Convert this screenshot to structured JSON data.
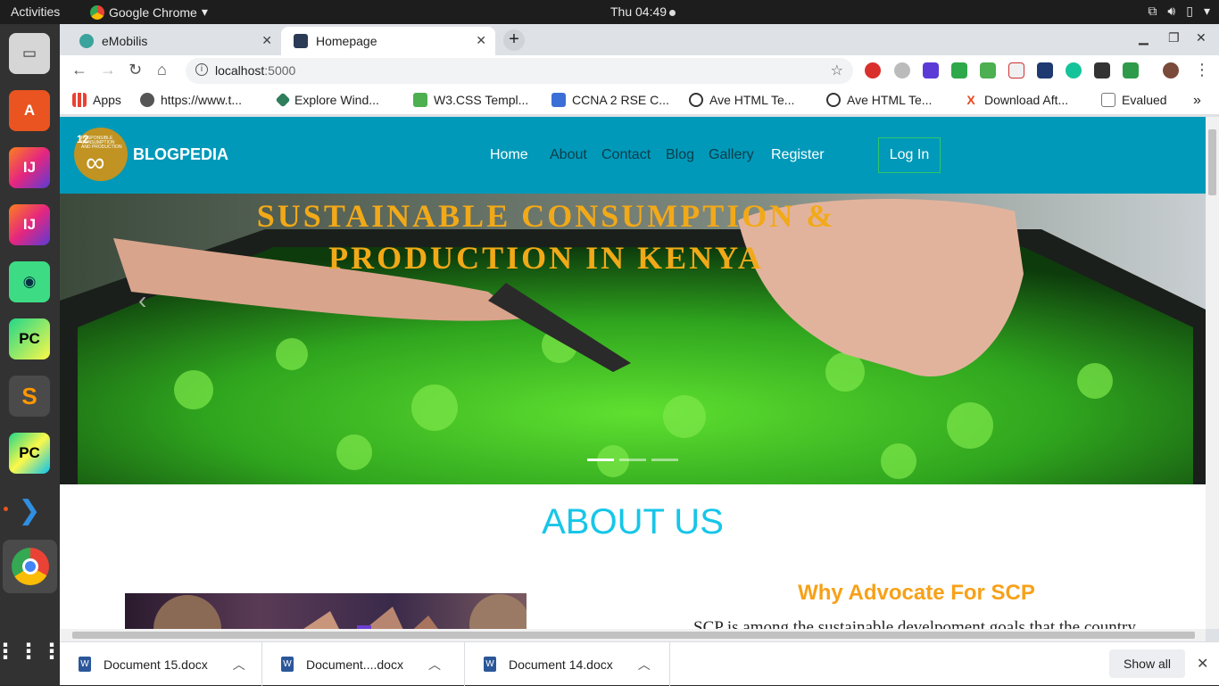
{
  "topbar": {
    "activities": "Activities",
    "app_name": "Google Chrome",
    "clock": "Thu 04:49"
  },
  "dock": {
    "items": [
      "files",
      "software-center",
      "intellij-idea",
      "intellij-idea",
      "android-studio",
      "pycharm",
      "sublime-text",
      "pycharm",
      "vscode",
      "chrome"
    ]
  },
  "browser": {
    "tabs": [
      {
        "title": "eMobilis",
        "active": false
      },
      {
        "title": "Homepage",
        "active": true
      }
    ],
    "url_host": "localhost",
    "url_port": ":5000",
    "bookmarks": [
      {
        "label": "Apps",
        "color": "#e94235"
      },
      {
        "label": "https://www.t...",
        "color": "#555555"
      },
      {
        "label": "Explore Wind...",
        "color": "#2e7d5b"
      },
      {
        "label": "W3.CSS Templ...",
        "color": "#4caf50"
      },
      {
        "label": "CCNA 2 RSE C...",
        "color": "#3b6fd6"
      },
      {
        "label": "Ave HTML Te...",
        "color": "#333333"
      },
      {
        "label": "Ave HTML Te...",
        "color": "#333333"
      },
      {
        "label": "Download Aft...",
        "color": "#e8461e"
      },
      {
        "label": "Evalued",
        "color": "#777777"
      }
    ]
  },
  "site": {
    "logo_text": "RESPONSIBLE CONSUMPTION AND PRODUCTION",
    "logo_number": "12",
    "brand": "BLOGPEDIA",
    "nav": [
      {
        "label": "Home",
        "color": "#ffffff"
      },
      {
        "label": "About",
        "color": "#0b3d4a"
      },
      {
        "label": "Contact",
        "color": "#0b3d4a"
      },
      {
        "label": "Blog",
        "color": "#0b3d4a"
      },
      {
        "label": "Gallery",
        "color": "#0b3d4a"
      },
      {
        "label": "Register",
        "color": "#ffffff"
      }
    ],
    "login": "Log In",
    "hero_title_line1": "SUSTAINABLE CONSUMPTION &",
    "hero_title_line2": "PRODUCTION IN KENYA",
    "carousel_active_index": 0,
    "about_title": "ABOUT US",
    "why_heading": "Why Advocate For SCP",
    "paragraph": "SCP is among the sustainable develpoment goals that the country is working towards. Blogpedia platform aims at educating on what SCP"
  },
  "downloads": {
    "items": [
      "Document 15.docx",
      "Document....docx",
      "Document 14.docx"
    ],
    "show_all": "Show all"
  },
  "colors": {
    "nav_bg": "#0199b9",
    "accent_orange": "#f7a118",
    "about_blue": "#17c6e8"
  }
}
